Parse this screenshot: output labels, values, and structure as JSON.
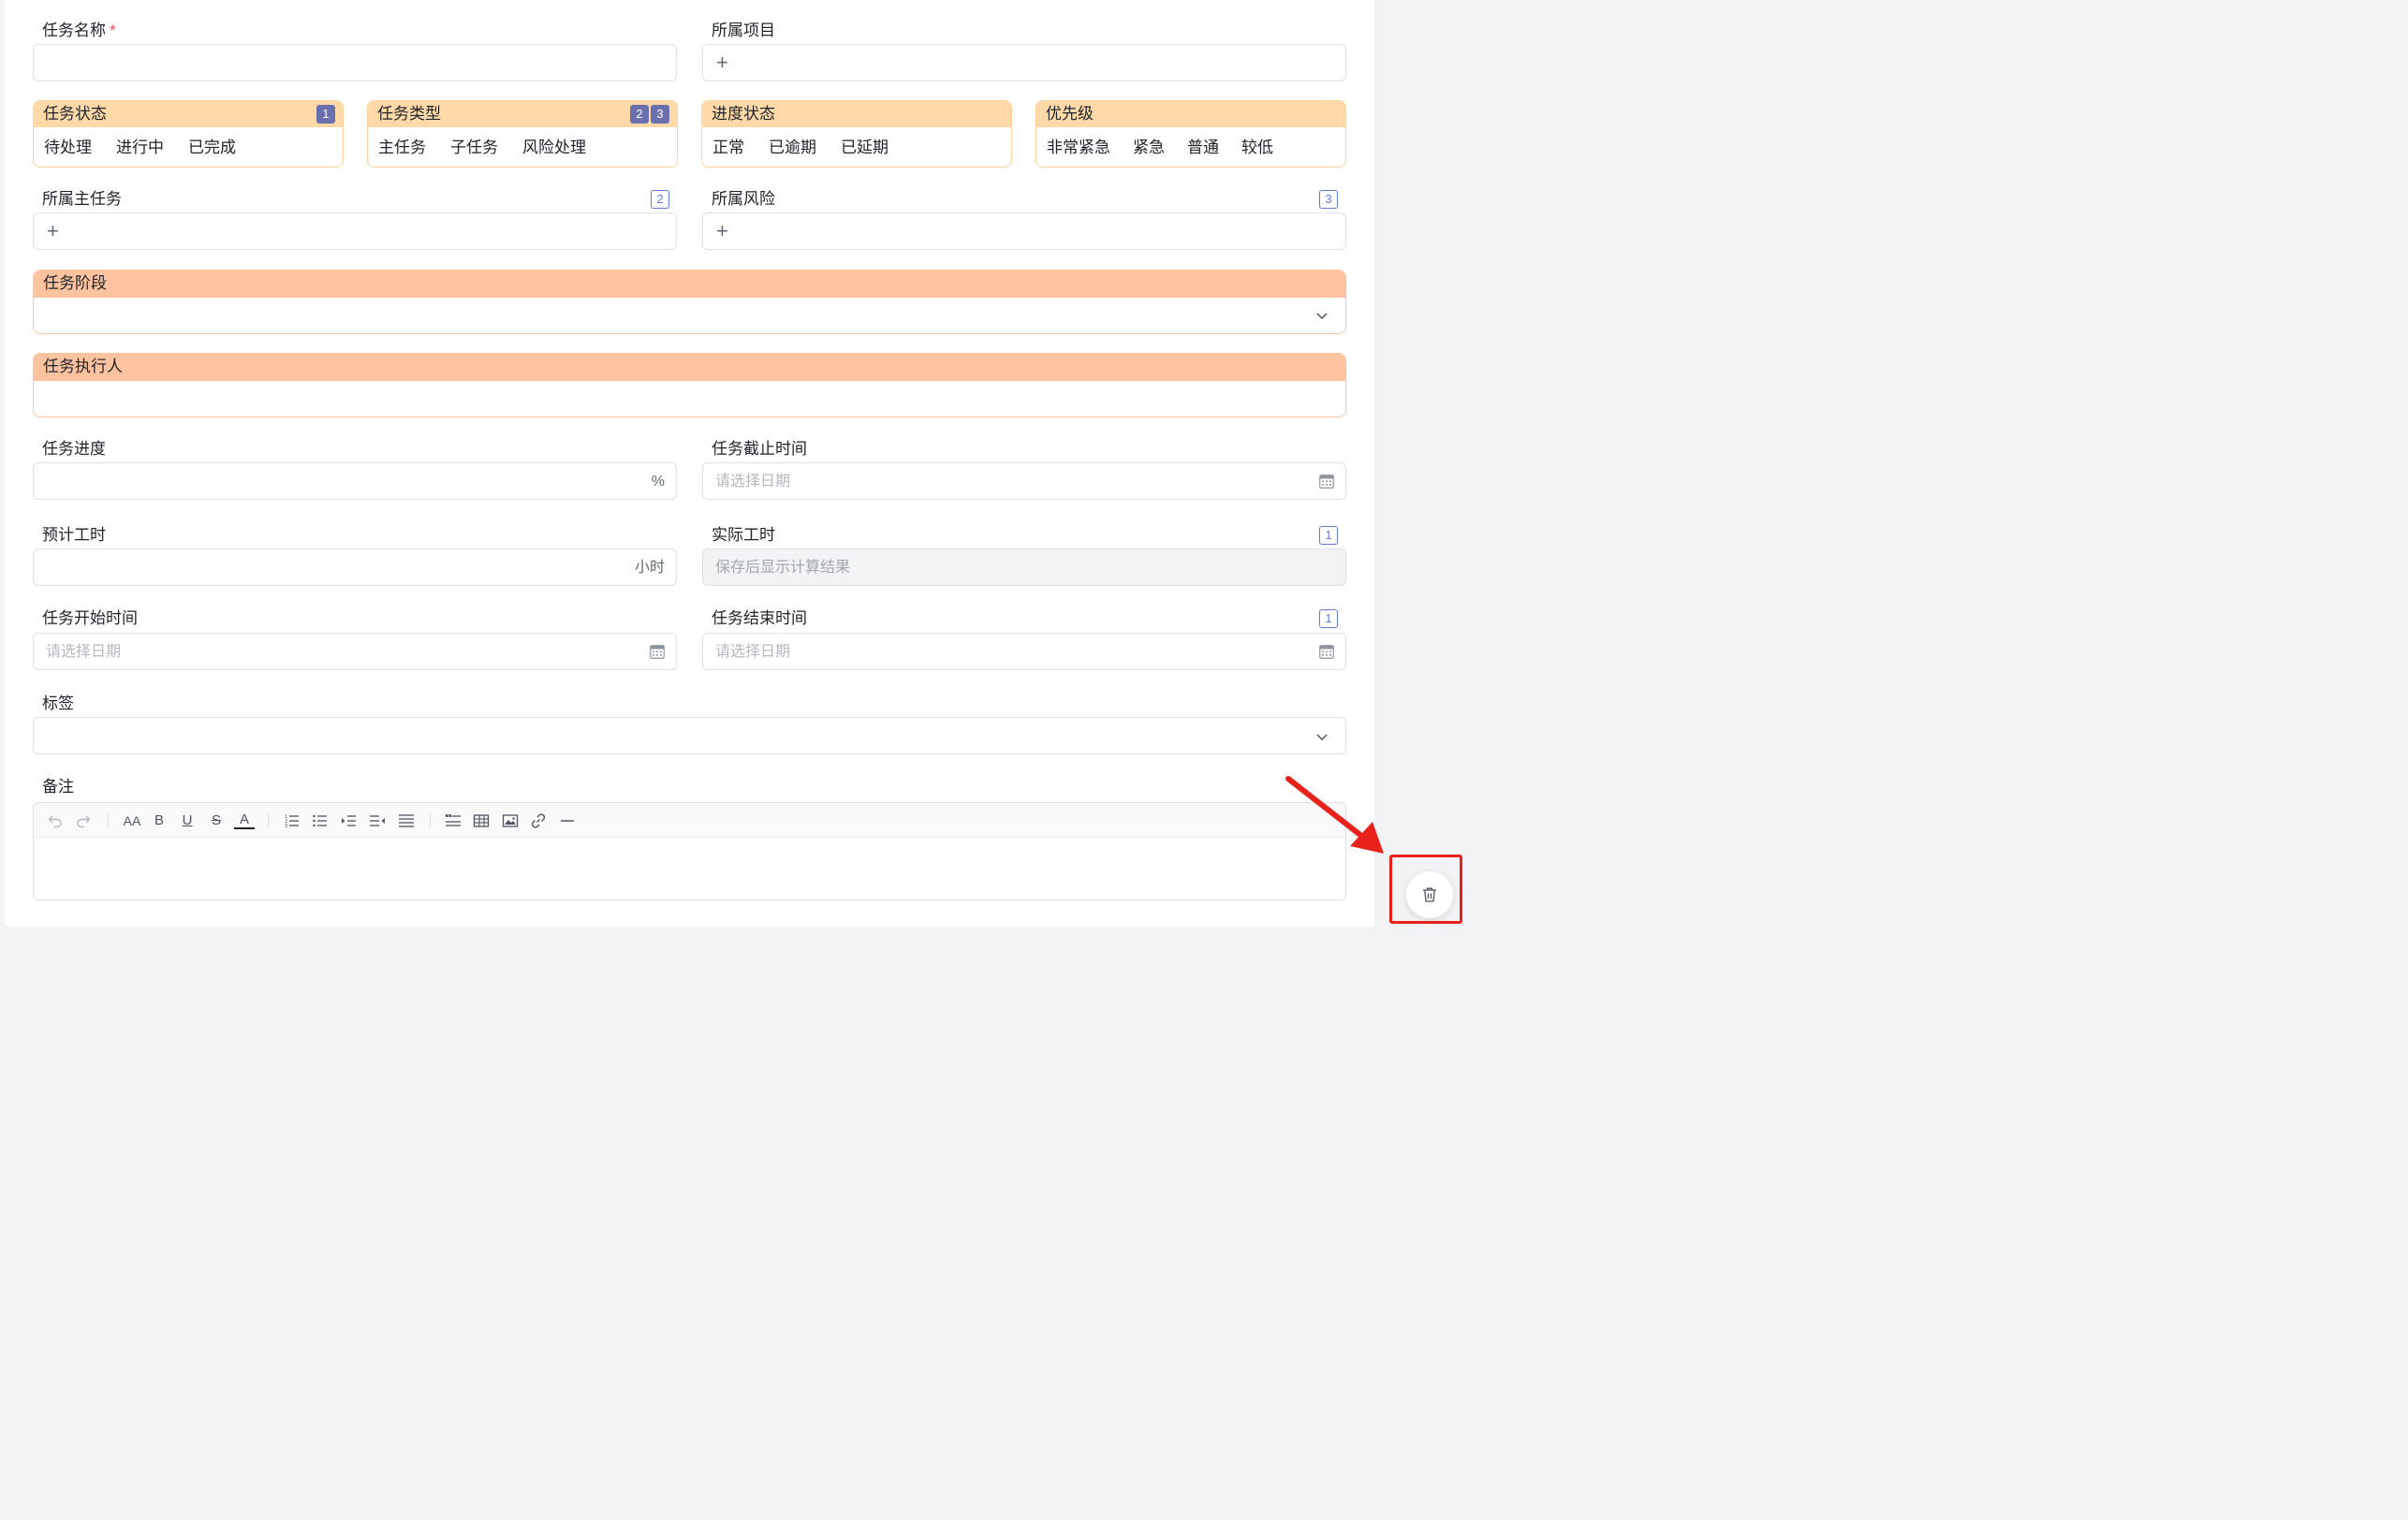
{
  "task_name": {
    "label": "任务名称",
    "required_mark": "*"
  },
  "project": {
    "label": "所属项目",
    "add": "+"
  },
  "groups": {
    "status": {
      "title": "任务状态",
      "badge": "1",
      "options": [
        "待处理",
        "进行中",
        "已完成"
      ]
    },
    "type": {
      "title": "任务类型",
      "badges": [
        "2",
        "3"
      ],
      "options": [
        "主任务",
        "子任务",
        "风险处理"
      ]
    },
    "progress_status": {
      "title": "进度状态",
      "options": [
        "正常",
        "已逾期",
        "已延期"
      ]
    },
    "priority": {
      "title": "优先级",
      "options": [
        "非常紧急",
        "紧急",
        "普通",
        "较低"
      ]
    }
  },
  "parent_task": {
    "label": "所属主任务",
    "badge": "2",
    "add": "+"
  },
  "risk": {
    "label": "所属风险",
    "badge": "3",
    "add": "+"
  },
  "stage": {
    "title": "任务阶段"
  },
  "assignee": {
    "title": "任务执行人"
  },
  "progress": {
    "label": "任务进度",
    "suffix": "%"
  },
  "deadline": {
    "label": "任务截止时间",
    "placeholder": "请选择日期"
  },
  "est_hours": {
    "label": "预计工时",
    "suffix": "小时"
  },
  "actual_hours": {
    "label": "实际工时",
    "badge": "1",
    "placeholder": "保存后显示计算结果"
  },
  "start_time": {
    "label": "任务开始时间",
    "placeholder": "请选择日期"
  },
  "end_time": {
    "label": "任务结束时间",
    "badge": "1",
    "placeholder": "请选择日期"
  },
  "tags": {
    "label": "标签"
  },
  "notes": {
    "label": "备注",
    "toolbar_font_size": "AA",
    "toolbar_bold": "B",
    "toolbar_underline": "U",
    "toolbar_strike": "S",
    "toolbar_color": "A"
  },
  "colors": {
    "group_header": "#ffd9a8",
    "section_header": "#ffc3a0",
    "badge": "#5e7ce0",
    "annotation": "#e8211b"
  },
  "icons": {
    "calendar": "calendar-icon",
    "chevron": "chevron-down-icon",
    "delete": "trash-icon"
  }
}
